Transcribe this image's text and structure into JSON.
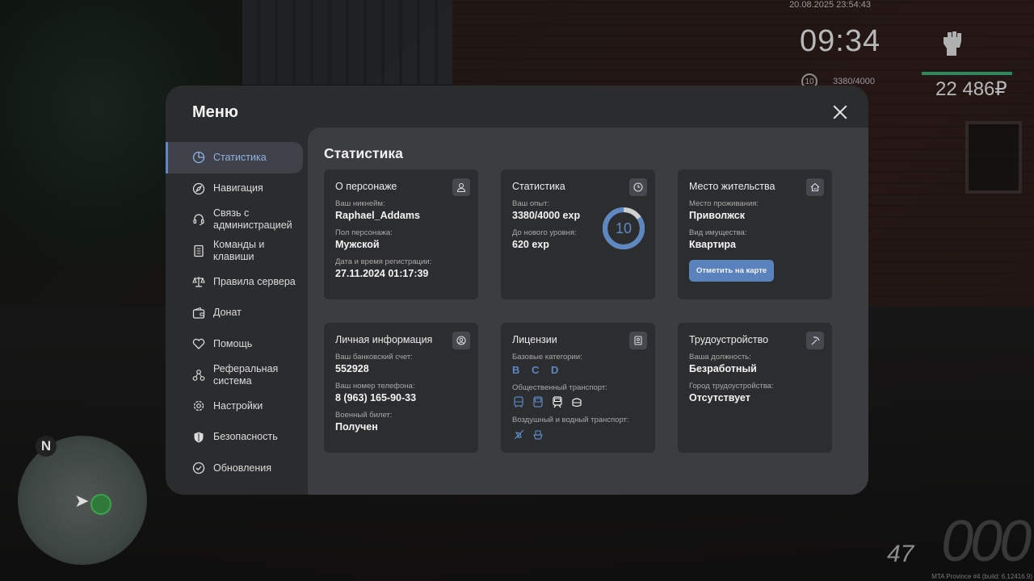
{
  "hud": {
    "datetime": "20.08.2025 23:54:43",
    "time": "09:34",
    "level": "10",
    "exp": "3380/4000",
    "money": "22 486₽",
    "speed": "47",
    "speed_big": "000",
    "build": "MTA Province #4 (build: 6.12416.9)",
    "minimap_north": "N"
  },
  "menu": {
    "title": "Меню",
    "nav": [
      {
        "label": "Статистика",
        "icon": "pie-chart-icon",
        "active": true
      },
      {
        "label": "Навигация",
        "icon": "compass-icon"
      },
      {
        "label": "Связь с администрацией",
        "icon": "headset-icon"
      },
      {
        "label": "Команды и клавиши",
        "icon": "document-list-icon"
      },
      {
        "label": "Правила сервера",
        "icon": "scales-icon"
      },
      {
        "label": "Донат",
        "icon": "wallet-icon"
      },
      {
        "label": "Помощь",
        "icon": "heart-hand-icon"
      },
      {
        "label": "Реферальная система",
        "icon": "network-icon"
      },
      {
        "label": "Настройки",
        "icon": "gear-icon"
      },
      {
        "label": "Безопасность",
        "icon": "shield-icon"
      },
      {
        "label": "Обновления",
        "icon": "check-circle-icon"
      }
    ]
  },
  "content": {
    "title": "Статистика",
    "character": {
      "title": "О персонаже",
      "nick_label": "Ваш никнейм:",
      "nick": "Raphael_Addams",
      "gender_label": "Пол персонажа:",
      "gender": "Мужской",
      "reg_label": "Дата и время регистрации:",
      "reg": "27.11.2024 01:17:39"
    },
    "stats": {
      "title": "Статистика",
      "exp_label": "Ваш опыт:",
      "exp": "3380/4000 exp",
      "next_label": "До нового уровня:",
      "next": "620 exp",
      "level": "10",
      "progress": 0.845
    },
    "residence": {
      "title": "Место жительства",
      "place_label": "Место проживания:",
      "place": "Приволжск",
      "type_label": "Вид имущества:",
      "type": "Квартира",
      "button": "Отметить на карте"
    },
    "personal": {
      "title": "Личная информация",
      "bank_label": "Ваш банковский счет:",
      "bank": "552928",
      "phone_label": "Ваш номер телефона:",
      "phone": "8 (963) 165-90-33",
      "military_label": "Военный билет:",
      "military": "Получен"
    },
    "licenses": {
      "title": "Лицензии",
      "basic_label": "Базовые категории:",
      "categories": [
        "B",
        "C",
        "D"
      ],
      "public_label": "Общественный транспорт:",
      "air_label": "Воздушный и водный транспорт:"
    },
    "employment": {
      "title": "Трудоустройство",
      "position_label": "Ваша должность:",
      "position": "Безработный",
      "city_label": "Город трудоустройства:",
      "city": "Отсутствует"
    }
  },
  "colors": {
    "accent": "#5e88c4",
    "panel": "#2b2c2e",
    "card": "#2c2d2f"
  }
}
